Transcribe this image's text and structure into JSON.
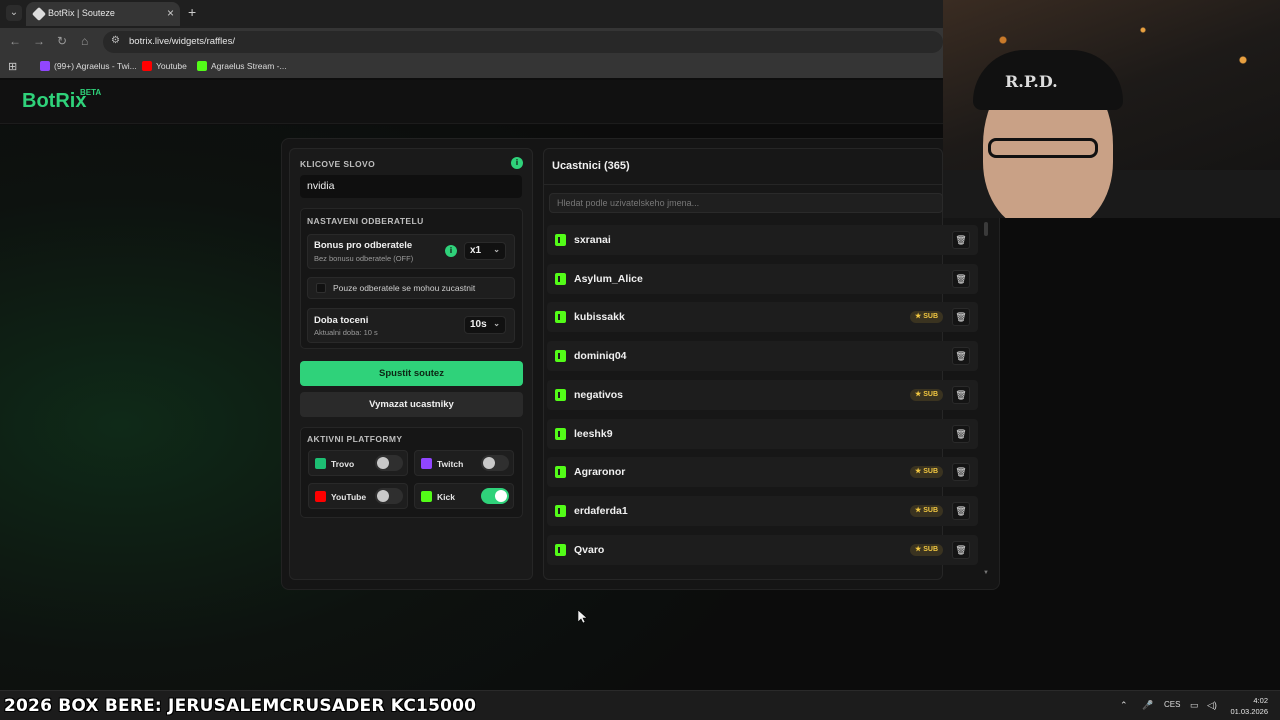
{
  "browser": {
    "tab_title": "BotRix | Souteze",
    "url": "botrix.live/widgets/raffles/",
    "bookmarks": [
      "(99+) Agraelus - Twi...",
      "Youtube",
      "Agraelus Stream -..."
    ]
  },
  "site": {
    "logo": "BotRix",
    "logo_badge": "BETA"
  },
  "left": {
    "keyword_label": "KLICOVE SLOVO",
    "keyword_value": "nvidia",
    "sub_section_label": "NASTAVENI ODBERATELU",
    "bonus_title": "Bonus pro odberatele",
    "bonus_sub": "Bez bonusu odberatele (OFF)",
    "bonus_value": "x1",
    "only_subs_label": "Pouze odberatele se mohou zucastnit",
    "spin_title": "Doba toceni",
    "spin_sub": "Aktualni doba: 10 s",
    "spin_value": "10s",
    "start_button": "Spustit soutez",
    "clear_button": "Vymazat ucastniky",
    "platforms_label": "AKTIVNI PLATFORMY",
    "platforms": [
      {
        "name": "Trovo",
        "enabled": false,
        "color": "#1dbf73"
      },
      {
        "name": "Twitch",
        "enabled": false,
        "color": "#9146ff"
      },
      {
        "name": "YouTube",
        "enabled": false,
        "color": "#ff0000"
      },
      {
        "name": "Kick",
        "enabled": true,
        "color": "#53fc18"
      }
    ]
  },
  "right": {
    "title": "Ucastnici (365)",
    "search_placeholder": "Hledat podle uzivatelskeho jmena...",
    "sub_badge": "SUB",
    "participants": [
      {
        "name": "sxranai",
        "sub": false
      },
      {
        "name": "Asylum_Alice",
        "sub": false
      },
      {
        "name": "kubissakk",
        "sub": true
      },
      {
        "name": "dominiq04",
        "sub": false
      },
      {
        "name": "negativos",
        "sub": true
      },
      {
        "name": "leeshk9",
        "sub": false
      },
      {
        "name": "Agraronor",
        "sub": true
      },
      {
        "name": "erdaferda1",
        "sub": true
      },
      {
        "name": "Qvaro",
        "sub": true
      }
    ]
  },
  "webcam": {
    "cap_text": "R.P.D."
  },
  "taskbar": {
    "ticker": "2026 BOX BERE: JERUSALEMCRUSADER  KC15000",
    "lang": "CES",
    "time": "4:02",
    "date": "01.03.2026"
  },
  "colors": {
    "accent": "#2fd27a",
    "kick": "#53fc18",
    "sub_badge": "#f3c841"
  }
}
